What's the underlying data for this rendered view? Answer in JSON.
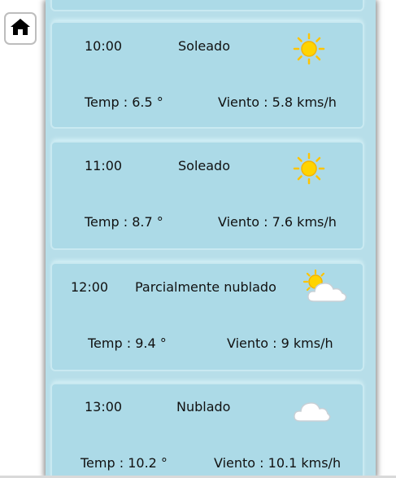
{
  "hours": [
    {
      "time": "10:00",
      "condition": "Soleado",
      "icon": "sun-icon",
      "temp": "Temp : 6.5 °",
      "wind": "Viento : 5.8 kms/h"
    },
    {
      "time": "11:00",
      "condition": "Soleado",
      "icon": "sun-icon",
      "temp": "Temp : 8.7 °",
      "wind": "Viento : 7.6 kms/h"
    },
    {
      "time": "12:00",
      "condition": "Parcialmente nublado",
      "icon": "partly-cloudy-icon",
      "temp": "Temp : 9.4 °",
      "wind": "Viento : 9 kms/h"
    },
    {
      "time": "13:00",
      "condition": "Nublado",
      "icon": "cloud-icon",
      "temp": "Temp : 10.2 °",
      "wind": "Viento : 10.1 kms/h"
    }
  ],
  "icons": {
    "home": "home-icon"
  },
  "colors": {
    "panel": "#b7dee9",
    "card": "#acdae7",
    "sun": "#ffd400"
  }
}
